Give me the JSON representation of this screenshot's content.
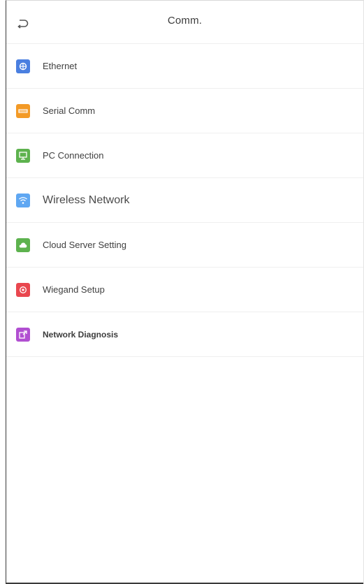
{
  "header": {
    "title": "Comm.",
    "back_icon": "back-arrow-icon"
  },
  "menu": [
    {
      "label": "Ethernet",
      "icon": "ethernet-icon",
      "color": "#4a7fe0"
    },
    {
      "label": "Serial Comm",
      "icon": "serial-comm-icon",
      "color": "#f39a26"
    },
    {
      "label": "PC Connection",
      "icon": "pc-connection-icon",
      "color": "#5db24e"
    },
    {
      "label": "Wireless Network",
      "icon": "wifi-icon",
      "color": "#5fa7f2"
    },
    {
      "label": "Cloud Server Setting",
      "icon": "cloud-icon",
      "color": "#5db24e"
    },
    {
      "label": "Wiegand Setup",
      "icon": "wiegand-icon",
      "color": "#e9474f"
    },
    {
      "label": "Network Diagnosis",
      "icon": "network-diagnosis-icon",
      "color": "#b14fd1"
    }
  ]
}
